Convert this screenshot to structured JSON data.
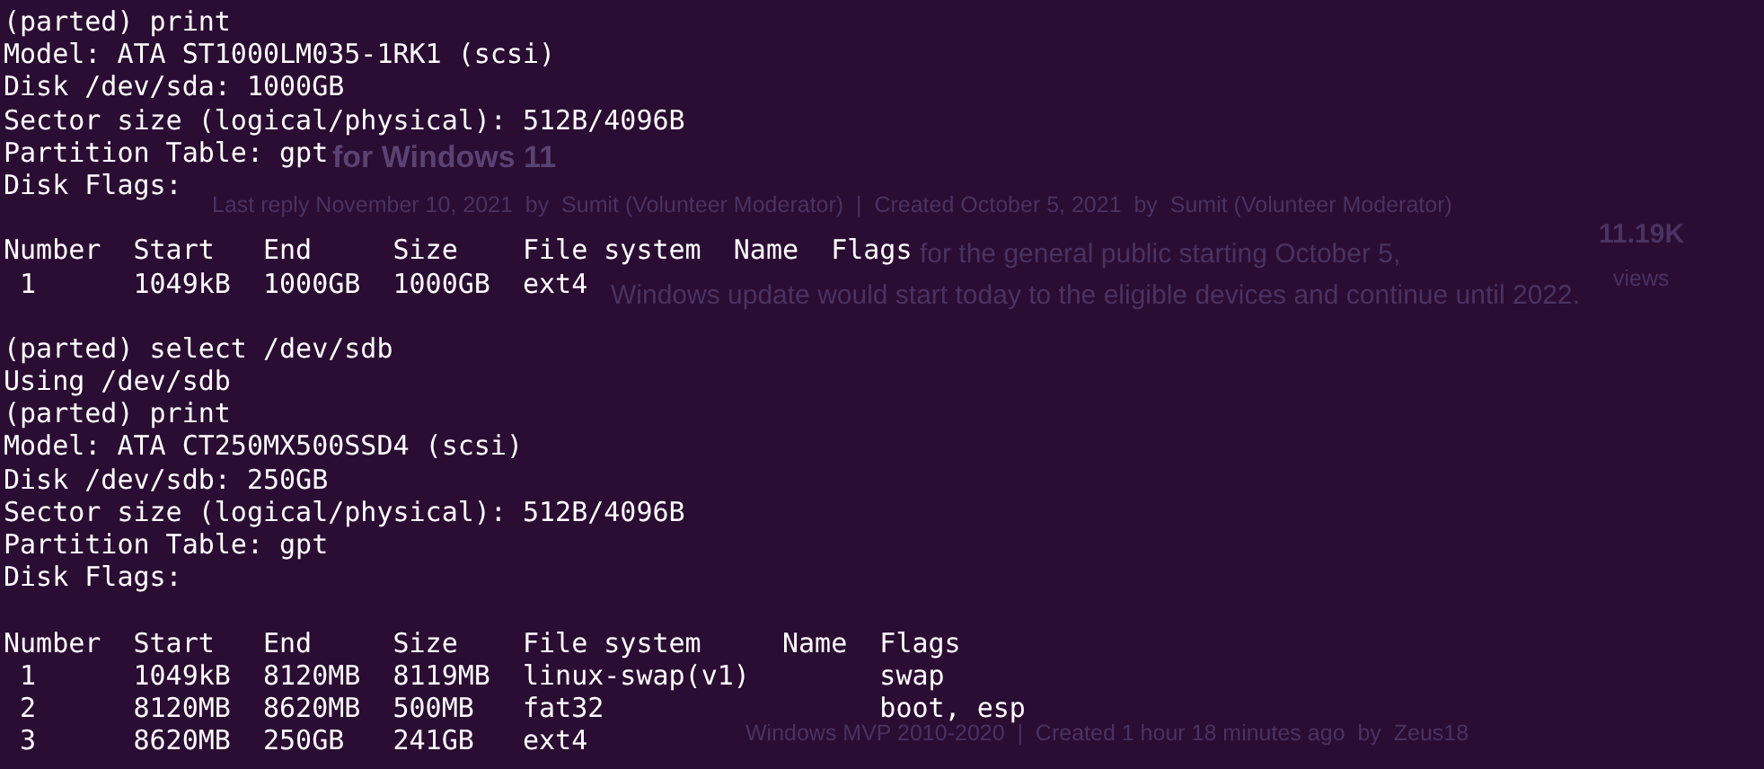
{
  "background_page": [
    {
      "kind": "heading",
      "text": "for Windows 11"
    },
    {
      "kind": "meta",
      "text": "Last reply November 10, 2021  by  Sumit (Volunteer Moderator)  |  Created October 5, 2021  by  Sumit (Volunteer Moderator)"
    },
    {
      "kind": "count",
      "text": "11.19K"
    },
    {
      "kind": "body",
      "text": "for the general public starting October 5,"
    },
    {
      "kind": "caption",
      "text": "views"
    },
    {
      "kind": "body2",
      "text": "Windows update would start today to the eligible devices and continue until 2022."
    },
    {
      "kind": "meta2",
      "text": "Windows MVP 2010-2020  |  Created 1 hour 18 minutes ago  by  Zeus18"
    }
  ],
  "terminal_lines": [
    {
      "kind": "text",
      "text": "(parted) print"
    },
    {
      "kind": "text",
      "text": "Model: ATA ST1000LM035-1RK1 (scsi)"
    },
    {
      "kind": "text",
      "text": "Disk /dev/sda: 1000GB"
    },
    {
      "kind": "text",
      "text": "Sector size (logical/physical): 512B/4096B"
    },
    {
      "kind": "text",
      "text": "Partition Table: gpt"
    },
    {
      "kind": "text",
      "text": "Disk Flags:"
    },
    {
      "kind": "blank"
    },
    {
      "kind": "text",
      "text": "Number  Start   End     Size    File system  Name  Flags"
    },
    {
      "kind": "text",
      "text": " 1      1049kB  1000GB  1000GB  ext4"
    },
    {
      "kind": "blank"
    },
    {
      "kind": "text",
      "text": "(parted) select /dev/sdb"
    },
    {
      "kind": "text",
      "text": "Using /dev/sdb"
    },
    {
      "kind": "text",
      "text": "(parted) print"
    },
    {
      "kind": "text",
      "text": "Model: ATA CT250MX500SSD4 (scsi)"
    },
    {
      "kind": "text",
      "text": "Disk /dev/sdb: 250GB"
    },
    {
      "kind": "text",
      "text": "Sector size (logical/physical): 512B/4096B"
    },
    {
      "kind": "text",
      "text": "Partition Table: gpt"
    },
    {
      "kind": "text",
      "text": "Disk Flags:"
    },
    {
      "kind": "blank"
    },
    {
      "kind": "text",
      "text": "Number  Start   End     Size    File system     Name  Flags"
    },
    {
      "kind": "text",
      "text": " 1      1049kB  8120MB  8119MB  linux-swap(v1)        swap"
    },
    {
      "kind": "text",
      "text": " 2      8120MB  8620MB  500MB   fat32                 boot, esp"
    },
    {
      "kind": "text",
      "text": " 3      8620MB  250GB   241GB   ext4"
    }
  ]
}
